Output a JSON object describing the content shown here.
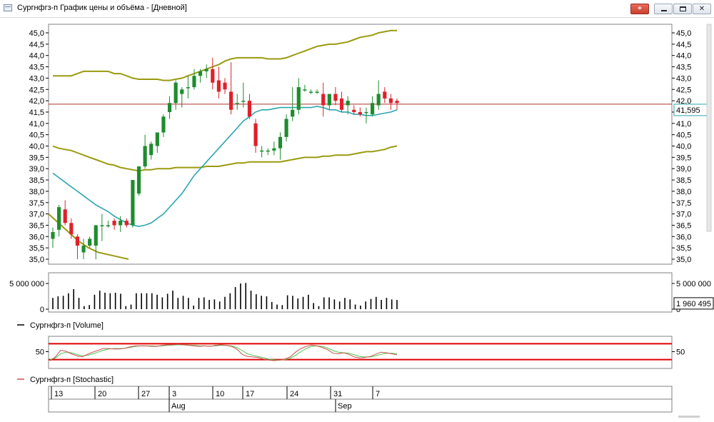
{
  "window": {
    "title": "Сургнфгз-п График цены и объёма - [Дневной]"
  },
  "colors": {
    "up": "#1e8c2e",
    "down": "#e0202a",
    "bollinger": "#9a9a10",
    "ma": "#2aa6b0",
    "last_price_line": "#b03030",
    "stoch_k": "#c85050",
    "stoch_d": "#50c850",
    "stoch_levels": "#e00000"
  },
  "price_axis": {
    "ticks": [
      "45,0",
      "44,5",
      "44,0",
      "43,5",
      "43,0",
      "42,5",
      "42,0",
      "41,5",
      "41,0",
      "40,5",
      "40,0",
      "39,5",
      "39,0",
      "38,5",
      "38,0",
      "37,5",
      "37,0",
      "36,5",
      "36,0",
      "35,5",
      "35,0"
    ],
    "right_label": "41,595"
  },
  "volume_axis": {
    "left_ticks": [
      "5 000 000",
      "0"
    ],
    "right_ticks": [
      "5 000 000",
      "0"
    ],
    "right_label": "1 960 495"
  },
  "stoch_axis": {
    "left_tick": "50",
    "right_tick": "50"
  },
  "legends": {
    "volume": "Сургнфгз-п [Volume]",
    "stochastic": "Сургнфгз-п [Stochastic]"
  },
  "time_axis": {
    "day_ticks": [
      "13",
      "20",
      "27",
      "3",
      "10",
      "17",
      "24",
      "31",
      "7"
    ],
    "months": [
      "Aug",
      "Sep"
    ]
  },
  "chart_data": [
    {
      "type": "candlestick",
      "name": "Сургнфгз-п",
      "ylim": [
        35.0,
        45.0
      ],
      "last_value": 41.595,
      "price_line": 41.85,
      "candles": [
        {
          "o": 35.9,
          "h": 36.4,
          "l": 35.5,
          "c": 36.2
        },
        {
          "o": 36.3,
          "h": 37.4,
          "l": 36.0,
          "c": 37.3
        },
        {
          "o": 37.2,
          "h": 37.6,
          "l": 36.5,
          "c": 36.6
        },
        {
          "o": 36.6,
          "h": 36.8,
          "l": 35.9,
          "c": 36.1
        },
        {
          "o": 36.0,
          "h": 36.1,
          "l": 35.0,
          "c": 35.6
        },
        {
          "o": 35.3,
          "h": 35.9,
          "l": 35.0,
          "c": 35.6
        },
        {
          "o": 35.6,
          "h": 36.0,
          "l": 35.5,
          "c": 35.9
        },
        {
          "o": 35.6,
          "h": 36.5,
          "l": 35.0,
          "c": 36.5
        },
        {
          "o": 36.5,
          "h": 37.0,
          "l": 35.8,
          "c": 36.5
        },
        {
          "o": 36.5,
          "h": 36.7,
          "l": 36.4,
          "c": 36.5
        },
        {
          "o": 36.7,
          "h": 36.8,
          "l": 36.3,
          "c": 36.5
        },
        {
          "o": 36.5,
          "h": 36.9,
          "l": 36.2,
          "c": 36.7
        },
        {
          "o": 36.7,
          "h": 36.8,
          "l": 36.4,
          "c": 36.5
        },
        {
          "o": 36.5,
          "h": 38.5,
          "l": 36.4,
          "c": 38.5
        },
        {
          "o": 37.9,
          "h": 39.1,
          "l": 37.8,
          "c": 39.1
        },
        {
          "o": 39.1,
          "h": 40.5,
          "l": 39.0,
          "c": 40.0
        },
        {
          "o": 39.6,
          "h": 40.2,
          "l": 39.4,
          "c": 40.1
        },
        {
          "o": 40.0,
          "h": 40.5,
          "l": 39.7,
          "c": 40.6
        },
        {
          "o": 40.6,
          "h": 41.4,
          "l": 40.4,
          "c": 41.3
        },
        {
          "o": 41.5,
          "h": 42.2,
          "l": 41.2,
          "c": 41.9
        },
        {
          "o": 41.9,
          "h": 42.9,
          "l": 41.6,
          "c": 42.8
        },
        {
          "o": 42.3,
          "h": 42.6,
          "l": 41.7,
          "c": 42.5
        },
        {
          "o": 42.6,
          "h": 43.1,
          "l": 42.1,
          "c": 42.6
        },
        {
          "o": 42.6,
          "h": 43.4,
          "l": 42.5,
          "c": 43.1
        },
        {
          "o": 43.1,
          "h": 43.4,
          "l": 42.8,
          "c": 43.3
        },
        {
          "o": 43.3,
          "h": 43.6,
          "l": 43.0,
          "c": 43.4
        },
        {
          "o": 43.4,
          "h": 43.9,
          "l": 42.5,
          "c": 42.8
        },
        {
          "o": 42.9,
          "h": 43.5,
          "l": 42.1,
          "c": 42.4
        },
        {
          "o": 42.8,
          "h": 43.0,
          "l": 42.3,
          "c": 42.5
        },
        {
          "o": 42.4,
          "h": 43.7,
          "l": 41.4,
          "c": 41.6
        },
        {
          "o": 41.9,
          "h": 42.3,
          "l": 41.6,
          "c": 41.9
        },
        {
          "o": 42.0,
          "h": 42.8,
          "l": 41.7,
          "c": 42.0
        },
        {
          "o": 42.0,
          "h": 42.3,
          "l": 41.2,
          "c": 41.3
        },
        {
          "o": 41.0,
          "h": 41.2,
          "l": 39.7,
          "c": 40.0
        },
        {
          "o": 39.8,
          "h": 40.0,
          "l": 39.5,
          "c": 39.8
        },
        {
          "o": 39.8,
          "h": 39.9,
          "l": 39.6,
          "c": 39.8
        },
        {
          "o": 39.8,
          "h": 40.2,
          "l": 39.6,
          "c": 39.9
        },
        {
          "o": 39.9,
          "h": 40.6,
          "l": 39.4,
          "c": 40.4
        },
        {
          "o": 40.4,
          "h": 41.4,
          "l": 40.2,
          "c": 41.2
        },
        {
          "o": 41.3,
          "h": 42.6,
          "l": 41.1,
          "c": 41.6
        },
        {
          "o": 41.6,
          "h": 43.0,
          "l": 41.4,
          "c": 42.6
        },
        {
          "o": 42.5,
          "h": 42.7,
          "l": 42.4,
          "c": 42.5
        },
        {
          "o": 42.4,
          "h": 42.5,
          "l": 42.3,
          "c": 42.4
        },
        {
          "o": 42.4,
          "h": 42.5,
          "l": 42.3,
          "c": 42.4
        },
        {
          "o": 42.3,
          "h": 42.8,
          "l": 41.3,
          "c": 41.8
        },
        {
          "o": 41.8,
          "h": 42.3,
          "l": 41.6,
          "c": 42.3
        },
        {
          "o": 42.3,
          "h": 42.6,
          "l": 41.8,
          "c": 42.0
        },
        {
          "o": 42.1,
          "h": 42.4,
          "l": 41.5,
          "c": 41.6
        },
        {
          "o": 41.8,
          "h": 42.2,
          "l": 41.4,
          "c": 42.0
        },
        {
          "o": 41.6,
          "h": 41.8,
          "l": 41.4,
          "c": 41.5
        },
        {
          "o": 41.5,
          "h": 41.7,
          "l": 41.3,
          "c": 41.4
        },
        {
          "o": 41.5,
          "h": 41.7,
          "l": 41.0,
          "c": 41.5
        },
        {
          "o": 41.4,
          "h": 42.2,
          "l": 41.3,
          "c": 41.9
        },
        {
          "o": 41.8,
          "h": 42.9,
          "l": 41.6,
          "c": 42.3
        },
        {
          "o": 42.4,
          "h": 42.6,
          "l": 41.9,
          "c": 42.1
        },
        {
          "o": 42.1,
          "h": 42.3,
          "l": 41.6,
          "c": 41.9
        },
        {
          "o": 42.0,
          "h": 42.1,
          "l": 41.6,
          "c": 41.9
        }
      ],
      "bollinger_upper": [
        43.1,
        43.1,
        43.1,
        43.1,
        43.2,
        43.3,
        43.3,
        43.3,
        43.3,
        43.3,
        43.2,
        43.2,
        43.1,
        43.0,
        42.95,
        42.95,
        42.95,
        42.95,
        42.9,
        42.9,
        42.95,
        43.0,
        43.1,
        43.2,
        43.3,
        43.4,
        43.5,
        43.6,
        43.75,
        43.85,
        43.9,
        43.9,
        43.9,
        43.9,
        43.9,
        43.85,
        43.85,
        43.85,
        43.9,
        44.0,
        44.1,
        44.2,
        44.3,
        44.4,
        44.45,
        44.5,
        44.5,
        44.55,
        44.6,
        44.7,
        44.8,
        44.85,
        44.9,
        45.0,
        45.05,
        45.1,
        45.1
      ],
      "bollinger_lower": [
        40.0,
        39.9,
        39.85,
        39.8,
        39.7,
        39.6,
        39.5,
        39.4,
        39.3,
        39.2,
        39.15,
        39.05,
        39.0,
        38.95,
        38.9,
        38.95,
        38.95,
        39.0,
        39.0,
        39.0,
        39.05,
        39.05,
        39.05,
        39.05,
        39.05,
        39.1,
        39.1,
        39.1,
        39.15,
        39.2,
        39.25,
        39.25,
        39.3,
        39.3,
        39.3,
        39.3,
        39.3,
        39.3,
        39.35,
        39.4,
        39.45,
        39.5,
        39.5,
        39.5,
        39.55,
        39.55,
        39.6,
        39.6,
        39.6,
        39.65,
        39.7,
        39.75,
        39.75,
        39.8,
        39.85,
        39.95,
        40.0
      ],
      "moving_average": [
        38.8,
        38.6,
        38.4,
        38.2,
        38.0,
        37.8,
        37.6,
        37.4,
        37.25,
        37.1,
        36.9,
        36.75,
        36.6,
        36.5,
        36.45,
        36.5,
        36.6,
        36.8,
        37.0,
        37.3,
        37.6,
        37.9,
        38.3,
        38.7,
        39.0,
        39.3,
        39.6,
        39.9,
        40.2,
        40.5,
        40.8,
        41.1,
        41.3,
        41.5,
        41.6,
        41.6,
        41.65,
        41.7,
        41.7,
        41.7,
        41.7,
        41.7,
        41.7,
        41.75,
        41.7,
        41.6,
        41.6,
        41.5,
        41.5,
        41.4,
        41.4,
        41.35,
        41.35,
        41.4,
        41.45,
        41.5,
        41.6
      ],
      "bollinger_lower_early": [
        37.0,
        36.6,
        36.2,
        35.8,
        35.5,
        35.3,
        35.2,
        35.1,
        35.0
      ]
    },
    {
      "type": "bar",
      "name": "Сургнфгз-п [Volume]",
      "ylim": [
        0,
        6000000
      ],
      "last_value": 1960495,
      "values": [
        2200000,
        2500000,
        2600000,
        3100000,
        3900000,
        2200000,
        600000,
        800000,
        2800000,
        3600000,
        3200000,
        3100000,
        3200000,
        3000000,
        600000,
        900000,
        3100000,
        3100000,
        3100000,
        3100000,
        2800000,
        2300000,
        3000000,
        3600000,
        2200000,
        2600000,
        2200000,
        700000,
        2200000,
        2300000,
        1800000,
        1900000,
        1500000,
        2400000,
        3100000,
        4300000,
        5000000,
        5100000,
        3600000,
        2900000,
        2600000,
        2500000,
        1400000,
        900000,
        800000,
        2700000,
        2600000,
        2100000,
        2400000,
        2800000,
        1200000,
        600000,
        2300000,
        2300000,
        1900000,
        1500000,
        2200000,
        1900000,
        900000,
        700000,
        1500000,
        2000000,
        2400000,
        1800000,
        2200000,
        1900000,
        1800000
      ],
      "note_values_visible": true
    },
    {
      "type": "line",
      "name": "Сургнфгз-п [Stochastic]",
      "ylim": [
        0,
        100
      ],
      "levels": [
        80,
        20
      ],
      "series_k": [
        15,
        30,
        55,
        52,
        42,
        35,
        30,
        40,
        48,
        55,
        62,
        62,
        60,
        60,
        63,
        68,
        72,
        72,
        72,
        70,
        70,
        74,
        76,
        76,
        78,
        76,
        74,
        72,
        70,
        72,
        70,
        74,
        76,
        74,
        70,
        60,
        40,
        32,
        30,
        28,
        22,
        18,
        16,
        18,
        22,
        30,
        48,
        62,
        70,
        75,
        72,
        66,
        58,
        44,
        42,
        46,
        40,
        30,
        26,
        28,
        32,
        40,
        48,
        46,
        42,
        38
      ],
      "series_d": [
        20,
        26,
        42,
        48,
        46,
        40,
        34,
        36,
        42,
        48,
        55,
        60,
        62,
        62,
        63,
        66,
        70,
        72,
        72,
        72,
        71,
        72,
        74,
        75,
        76,
        76,
        75,
        74,
        72,
        72,
        71,
        72,
        74,
        74,
        72,
        66,
        54,
        42,
        36,
        32,
        27,
        22,
        19,
        18,
        20,
        25,
        36,
        50,
        62,
        70,
        72,
        70,
        64,
        54,
        48,
        46,
        44,
        38,
        32,
        30,
        30,
        34,
        40,
        44,
        44,
        42
      ]
    }
  ]
}
